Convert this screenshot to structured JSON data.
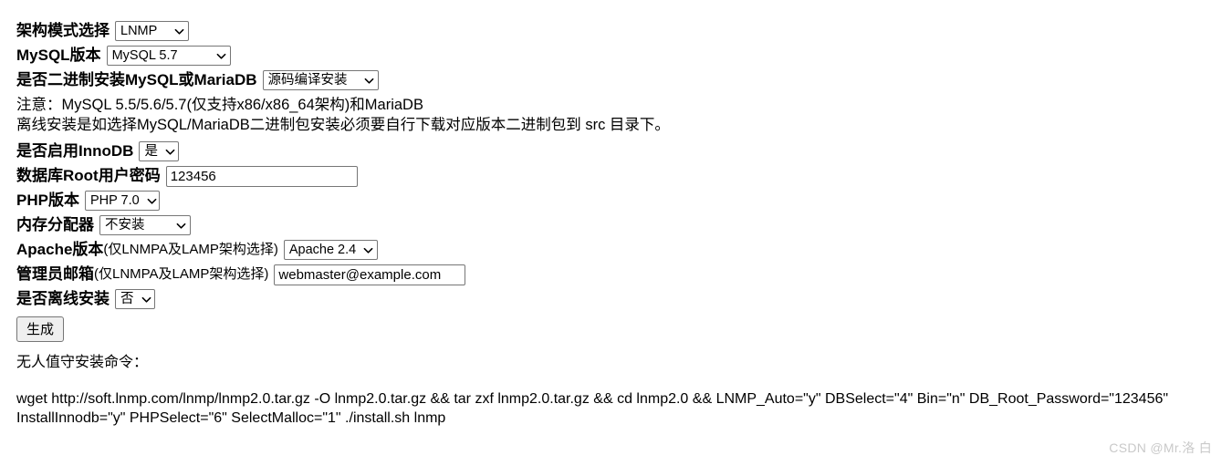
{
  "form": {
    "rows": [
      {
        "label": "架构模式选择",
        "control": "select",
        "value": "LNMP"
      },
      {
        "label": "MySQL版本",
        "control": "select",
        "value": "MySQL 5.7"
      },
      {
        "label": "是否二进制安装MySQL或MariaDB",
        "control": "select",
        "value": "源码编译安装"
      },
      {
        "label": "是否启用InnoDB",
        "control": "select",
        "value": "是"
      },
      {
        "label": "数据库Root用户密码",
        "control": "text",
        "value": "123456"
      },
      {
        "label": "PHP版本",
        "control": "select",
        "value": "PHP 7.0"
      },
      {
        "label": "内存分配器",
        "control": "select",
        "value": "不安装"
      },
      {
        "label": "Apache版本",
        "sublabel": "(仅LNMPA及LAMP架构选择)",
        "control": "select",
        "value": "Apache 2.4"
      },
      {
        "label": "管理员邮箱",
        "sublabel": "(仅LNMPA及LAMP架构选择)",
        "control": "text",
        "value": "webmaster@example.com"
      },
      {
        "label": "是否离线安装",
        "control": "select",
        "value": "否"
      }
    ],
    "generate_button": "生成"
  },
  "notes": {
    "line1": "注意：MySQL 5.5/5.6/5.7(仅支持x86/x86_64架构)和MariaDB",
    "line2": "离线安装是如选择MySQL/MariaDB二进制包安装必须要自行下载对应版本二进制包到 src 目录下。"
  },
  "command": {
    "title": "无人值守安装命令：",
    "text": "wget http://soft.lnmp.com/lnmp/lnmp2.0.tar.gz -O lnmp2.0.tar.gz && tar zxf lnmp2.0.tar.gz && cd lnmp2.0 && LNMP_Auto=\"y\" DBSelect=\"4\" Bin=\"n\" DB_Root_Password=\"123456\" InstallInnodb=\"y\" PHPSelect=\"6\" SelectMalloc=\"1\" ./install.sh lnmp"
  },
  "watermark": {
    "text": "CSDN @Mr.洛 白"
  },
  "icons": {
    "chevron_down": "chevron-down-icon"
  }
}
